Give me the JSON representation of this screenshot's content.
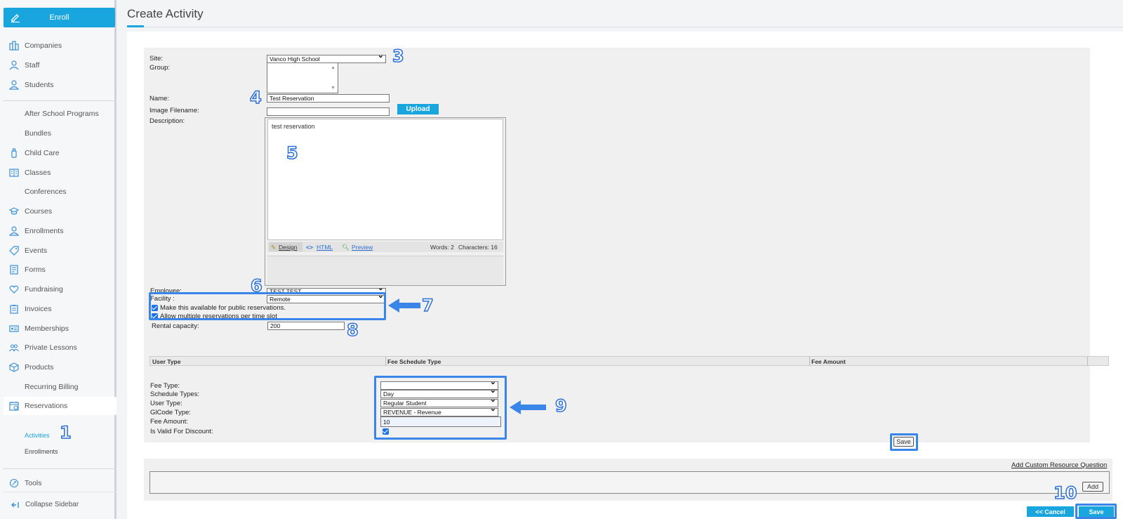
{
  "sidebar": {
    "enroll_label": "Enroll",
    "items": [
      {
        "label": "Companies",
        "icon": "building-icon"
      },
      {
        "label": "Staff",
        "icon": "staff-icon"
      },
      {
        "label": "Students",
        "icon": "user-icon"
      },
      {
        "label": "After School Programs",
        "icon": ""
      },
      {
        "label": "Bundles",
        "icon": ""
      },
      {
        "label": "Child Care",
        "icon": "bottle-icon"
      },
      {
        "label": "Classes",
        "icon": "book-icon"
      },
      {
        "label": "Conferences",
        "icon": ""
      },
      {
        "label": "Courses",
        "icon": "graduation-cap-icon"
      },
      {
        "label": "Enrollments",
        "icon": "user-icon"
      },
      {
        "label": "Events",
        "icon": "tag-icon"
      },
      {
        "label": "Forms",
        "icon": "form-icon"
      },
      {
        "label": "Fundraising",
        "icon": "heart-icon"
      },
      {
        "label": "Invoices",
        "icon": "clipboard-icon"
      },
      {
        "label": "Memberships",
        "icon": "id-card-icon"
      },
      {
        "label": "Private Lessons",
        "icon": "group-icon"
      },
      {
        "label": "Products",
        "icon": "box-icon"
      },
      {
        "label": "Recurring Billing",
        "icon": ""
      },
      {
        "label": "Reservations",
        "icon": "calendar-icon"
      },
      {
        "label": "Tools",
        "icon": "tools-icon"
      }
    ],
    "sub_items": [
      "Activities",
      "Enrollments"
    ],
    "collapse_label": "Collapse Sidebar"
  },
  "header": {
    "title": "Create Activity"
  },
  "form": {
    "site_label": "Site:",
    "site_value": "Vanco High School",
    "group_label": "Group:",
    "name_label": "Name:",
    "name_value": "Test Reservation",
    "image_label": "Image Filename:",
    "upload_label": "Upload",
    "description_label": "Description:",
    "description_value": "test reservation",
    "editor": {
      "design": "Design",
      "html": "HTML",
      "preview": "Preview",
      "words": "Words: 2",
      "characters": "Characters: 16"
    },
    "employee_label": "Employee:",
    "employee_value": "TEST TEST",
    "facility_label": "Facility :",
    "facility_value": "Remote",
    "public_label": "Make this available for public reservations.",
    "multiple_label": "Allow multiple reservations per time slot",
    "rental_label": "Rental capacity:",
    "rental_value": "200"
  },
  "fee_table": {
    "headers": [
      "User Type",
      "Fee Schedule Type",
      "Fee Amount"
    ]
  },
  "fee_form": {
    "fee_type_label": "Fee Type:",
    "fee_type_value": "",
    "schedule_label": "Schedule Types:",
    "schedule_value": "Day",
    "user_type_label": "User Type:",
    "user_type_value": "Regular Student",
    "glcode_label": "GlCode Type:",
    "glcode_value": "REVENUE - Revenue",
    "fee_amount_label": "Fee Amount:",
    "fee_amount_value": "10",
    "discount_label": "Is Valid For Discount:",
    "save_label": "Save"
  },
  "resources": {
    "add_question": "Add Custom Resource Question",
    "add_label": "Add"
  },
  "footer": {
    "cancel_label": "<< Cancel",
    "save_label": "Save"
  },
  "callouts": [
    "1",
    "3",
    "4",
    "5",
    "6",
    "7",
    "8",
    "9",
    "10"
  ],
  "colors": {
    "accent": "#19a6df",
    "highlight": "#3a86e8"
  }
}
